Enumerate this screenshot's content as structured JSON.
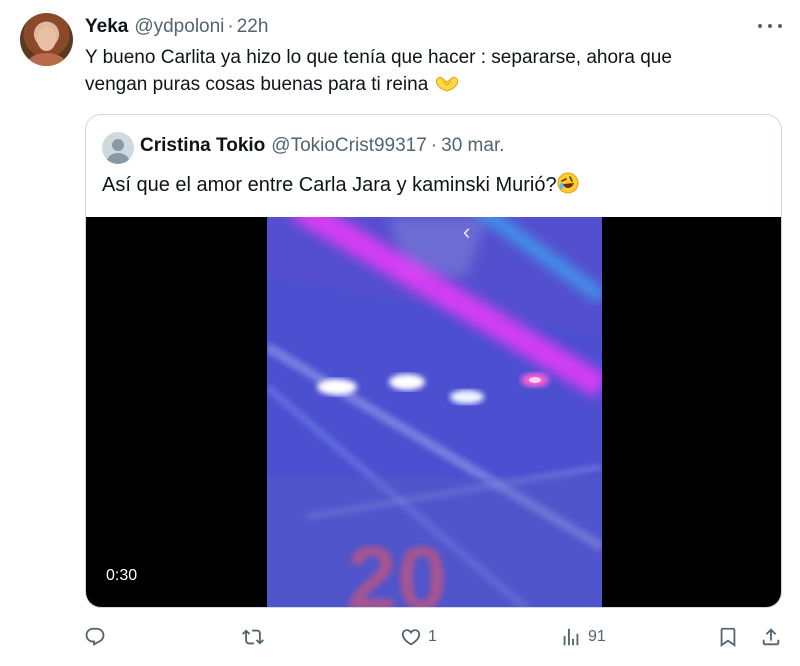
{
  "tweet": {
    "author_name": "Yeka",
    "author_handle": "@ydpoloni",
    "separator": "·",
    "time": "22h",
    "text_line1": "Y bueno Carlita ya hizo lo que tenía que  hacer : separarse, ahora que",
    "text_line2": "vengan puras cosas buenas para ti reina",
    "emoji": "heart-hands"
  },
  "quote": {
    "author_name": "Cristina Tokio",
    "author_handle": "@TokioCrist99317",
    "separator": "·",
    "time": "30 mar.",
    "text": "Así que el amor entre Carla Jara y kaminski Murió?",
    "emoji": "rolling-on-floor-laughing",
    "video": {
      "duration": "0:30"
    }
  },
  "actions": {
    "reply_count": "",
    "retweet_count": "",
    "like_count": "1",
    "views_count": "91"
  },
  "colors": {
    "text": "#0f1419",
    "secondary": "#536471",
    "border": "#cfd9de"
  }
}
